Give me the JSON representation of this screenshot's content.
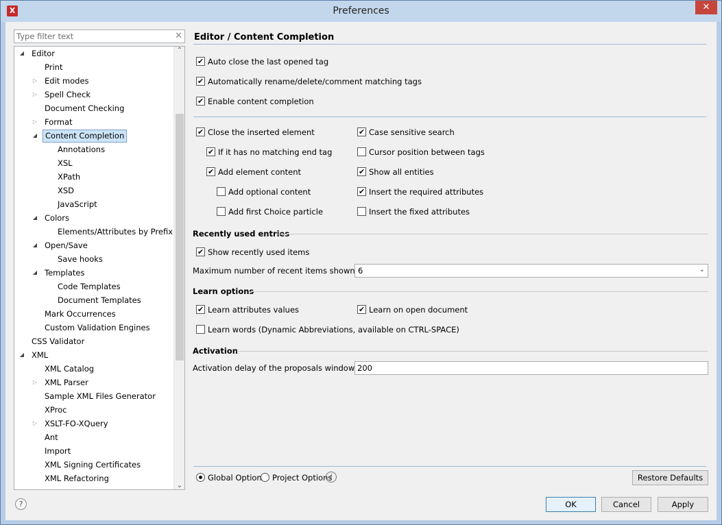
{
  "window": {
    "title": "Preferences",
    "app_icon_glyph": "X",
    "close_glyph": "✕"
  },
  "filter": {
    "placeholder": "Type filter text",
    "clear_glyph": "✕"
  },
  "tree": {
    "items": [
      {
        "label": "Editor",
        "level": 0,
        "twisty": "open"
      },
      {
        "label": "Print",
        "level": 1,
        "twisty": "none"
      },
      {
        "label": "Edit modes",
        "level": 1,
        "twisty": "closed"
      },
      {
        "label": "Spell Check",
        "level": 1,
        "twisty": "closed"
      },
      {
        "label": "Document Checking",
        "level": 1,
        "twisty": "none"
      },
      {
        "label": "Format",
        "level": 1,
        "twisty": "closed"
      },
      {
        "label": "Content Completion",
        "level": 1,
        "twisty": "open",
        "selected": true
      },
      {
        "label": "Annotations",
        "level": 2,
        "twisty": "none"
      },
      {
        "label": "XSL",
        "level": 2,
        "twisty": "none"
      },
      {
        "label": "XPath",
        "level": 2,
        "twisty": "none"
      },
      {
        "label": "XSD",
        "level": 2,
        "twisty": "none"
      },
      {
        "label": "JavaScript",
        "level": 2,
        "twisty": "none"
      },
      {
        "label": "Colors",
        "level": 1,
        "twisty": "open"
      },
      {
        "label": "Elements/Attributes by Prefix",
        "level": 2,
        "twisty": "none"
      },
      {
        "label": "Open/Save",
        "level": 1,
        "twisty": "open"
      },
      {
        "label": "Save hooks",
        "level": 2,
        "twisty": "none"
      },
      {
        "label": "Templates",
        "level": 1,
        "twisty": "open"
      },
      {
        "label": "Code Templates",
        "level": 2,
        "twisty": "none"
      },
      {
        "label": "Document Templates",
        "level": 2,
        "twisty": "none"
      },
      {
        "label": "Mark Occurrences",
        "level": 1,
        "twisty": "none"
      },
      {
        "label": "Custom Validation Engines",
        "level": 1,
        "twisty": "none"
      },
      {
        "label": "CSS Validator",
        "level": 0,
        "twisty": "none"
      },
      {
        "label": "XML",
        "level": 0,
        "twisty": "open"
      },
      {
        "label": "XML Catalog",
        "level": 1,
        "twisty": "none"
      },
      {
        "label": "XML Parser",
        "level": 1,
        "twisty": "closed"
      },
      {
        "label": "Sample XML Files Generator",
        "level": 1,
        "twisty": "none"
      },
      {
        "label": "XProc",
        "level": 1,
        "twisty": "none"
      },
      {
        "label": "XSLT-FO-XQuery",
        "level": 1,
        "twisty": "closed"
      },
      {
        "label": "Ant",
        "level": 1,
        "twisty": "none"
      },
      {
        "label": "Import",
        "level": 1,
        "twisty": "none"
      },
      {
        "label": "XML Signing Certificates",
        "level": 1,
        "twisty": "none"
      },
      {
        "label": "XML Refactoring",
        "level": 1,
        "twisty": "none"
      }
    ],
    "twisty_glyphs": {
      "open": "◢",
      "closed": "▷",
      "none": ""
    },
    "scroll_up_glyph": "⌃",
    "scroll_down_glyph": "⌄"
  },
  "help_glyph": "?",
  "page": {
    "title": "Editor / Content Completion",
    "top_options": [
      {
        "label": "Auto close the last opened tag",
        "checked": true
      },
      {
        "label": "Automatically rename/delete/comment matching tags",
        "checked": true
      },
      {
        "label": "Enable content completion",
        "checked": true
      }
    ],
    "left_options": [
      {
        "label": "Close the inserted element",
        "checked": true
      },
      {
        "label": "If it has no matching end tag",
        "checked": true
      },
      {
        "label": "Add element content",
        "checked": true
      },
      {
        "label": "Add optional content",
        "checked": false
      },
      {
        "label": "Add first Choice particle",
        "checked": false
      }
    ],
    "right_options": [
      {
        "label": "Case sensitive search",
        "checked": true
      },
      {
        "label": "Cursor position between tags",
        "checked": false
      },
      {
        "label": "Show all entities",
        "checked": true
      },
      {
        "label": "Insert the required attributes",
        "checked": true
      },
      {
        "label": "Insert the fixed attributes",
        "checked": false
      }
    ],
    "recent": {
      "heading": "Recently used entries",
      "show_label": "Show recently used items",
      "show_checked": true,
      "max_label": "Maximum number of recent items shown",
      "max_value": "6",
      "chevron_glyph": "⌄"
    },
    "learn": {
      "heading": "Learn options",
      "attributes_label": "Learn attributes values",
      "attributes_checked": true,
      "open_doc_label": "Learn on open document",
      "open_doc_checked": true,
      "words_label": "Learn words (Dynamic Abbreviations, available on CTRL-SPACE)",
      "words_checked": false
    },
    "activation": {
      "heading": "Activation",
      "delay_label": "Activation delay of the proposals window (ms)",
      "delay_value": "200"
    }
  },
  "footer": {
    "global_label": "Global Options",
    "global_selected": true,
    "project_label": "Project Options",
    "project_selected": false,
    "info_glyph": "i",
    "restore_label": "Restore Defaults",
    "ok_label": "OK",
    "cancel_label": "Cancel",
    "apply_label": "Apply"
  }
}
